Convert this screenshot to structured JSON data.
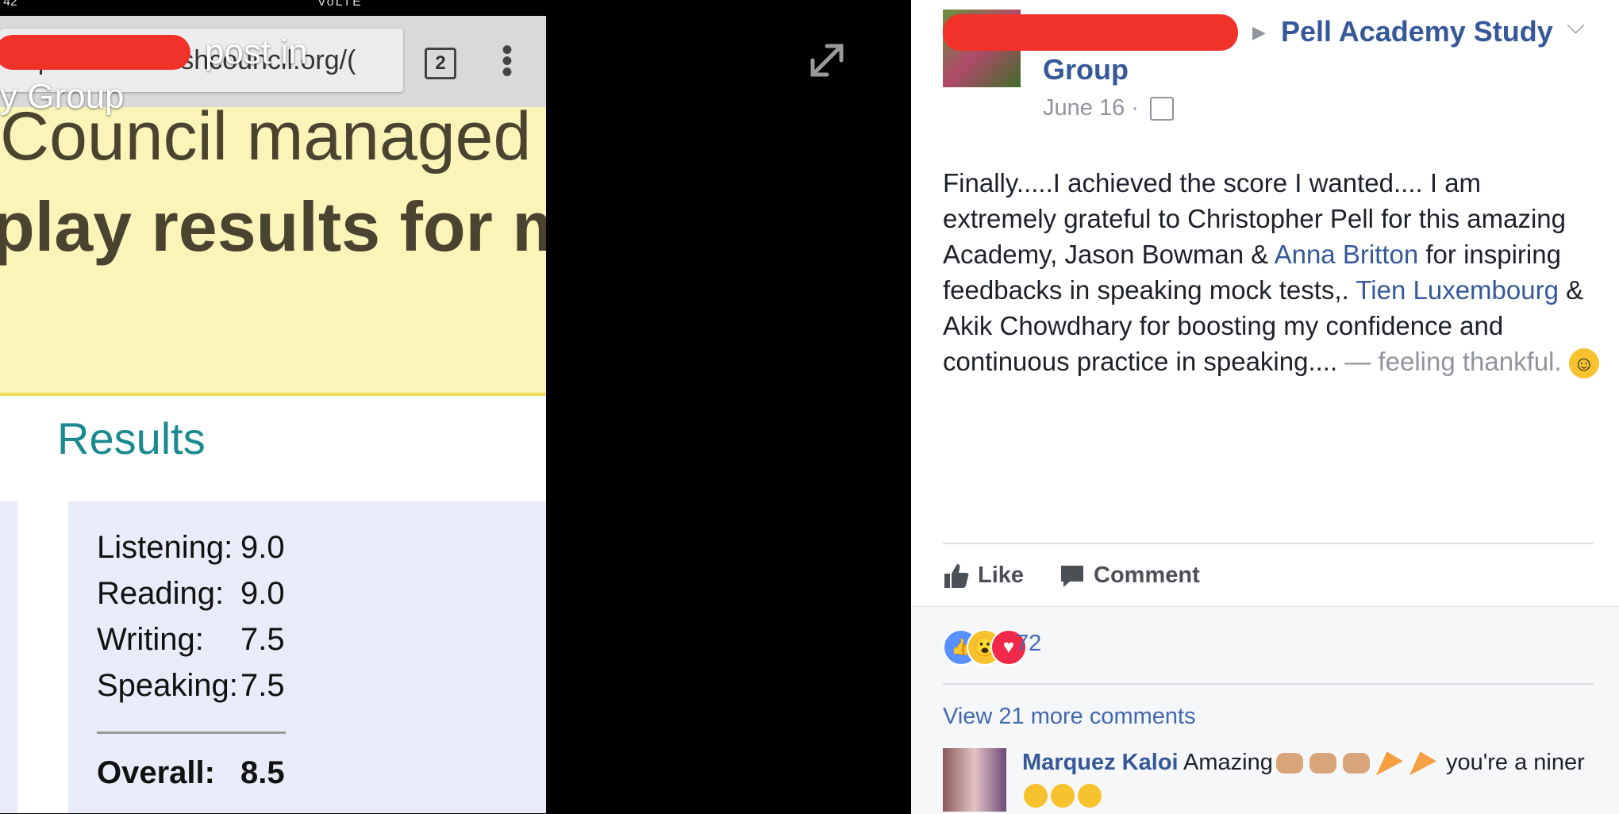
{
  "viewer": {
    "status_time": "42",
    "status_right": "VoLTE",
    "url": "https://ieltsbritishcouncil.org/(",
    "tabs_count": "2",
    "banner_line1": "Council managed",
    "banner_line2": "play results for mo",
    "results_title": "Results",
    "scores": [
      {
        "label": "Listening:",
        "value": "9.0"
      },
      {
        "label": "Reading:",
        "value": "9.0"
      },
      {
        "label": "Writing:",
        "value": "7.5"
      },
      {
        "label": "Speaking:",
        "value": "7.5"
      }
    ],
    "overall": {
      "label": "Overall:",
      "value": "8.5"
    },
    "caption_line1": "post in",
    "caption_line2": "y Group",
    "expand_icon": "expand-icon"
  },
  "post": {
    "group_name": "Pell Academy Study Group",
    "date": "June 16 ·",
    "audience_icon": "group-audience-icon",
    "text_part1": "Finally.....I achieved the score I wanted.... I am extremely grateful to Christopher Pell for this amazing Academy, Jason Bowman & ",
    "link1": "Anna Britton",
    "text_part2": " for inspiring feedbacks in speaking mock tests,. ",
    "link2": "Tien Luxembourg",
    "text_part3": " & Akik Chowdhary for boosting my confidence and continuous practice in speaking.... ",
    "feeling": "— feeling thankful.",
    "actions": {
      "like": "Like",
      "comment": "Comment"
    },
    "reaction_count": "72",
    "view_more": "View 21 more comments",
    "comment": {
      "author": "Marquez Kaloi",
      "text_before": " Amazing",
      "text_after": " you're a niner"
    }
  }
}
